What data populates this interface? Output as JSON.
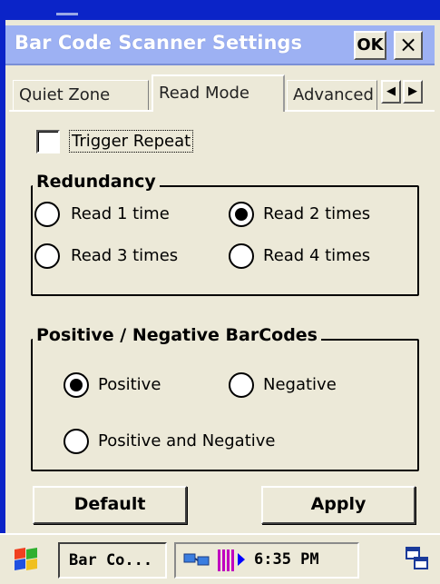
{
  "window": {
    "title": "Bar Code Scanner Settings",
    "ok_label": "OK",
    "close_label": "×"
  },
  "tabs": [
    {
      "label": "Quiet Zone",
      "active": false
    },
    {
      "label": "Read Mode",
      "active": true
    },
    {
      "label": "Advanced",
      "active": false
    }
  ],
  "tab_scroll": {
    "left": "◀",
    "right": "▶"
  },
  "trigger_repeat": {
    "label": "Trigger Repeat",
    "checked": false
  },
  "redundancy": {
    "title": "Redundancy",
    "options": [
      {
        "label": "Read 1 time",
        "selected": false
      },
      {
        "label": "Read 2 times",
        "selected": true
      },
      {
        "label": "Read 3 times",
        "selected": false
      },
      {
        "label": "Read 4 times",
        "selected": false
      }
    ]
  },
  "barcodes": {
    "title": "Positive / Negative BarCodes",
    "options": [
      {
        "label": "Positive",
        "selected": true
      },
      {
        "label": "Negative",
        "selected": false
      },
      {
        "label": "Positive and Negative",
        "selected": false
      }
    ]
  },
  "buttons": {
    "default_label": "Default",
    "apply_label": "Apply"
  },
  "taskbar": {
    "task_label": "Bar Co...",
    "clock": "6:35 PM"
  },
  "colors": {
    "titlebar": "#9db1f3",
    "frame": "#0b24c8",
    "face": "#ece9d8"
  }
}
